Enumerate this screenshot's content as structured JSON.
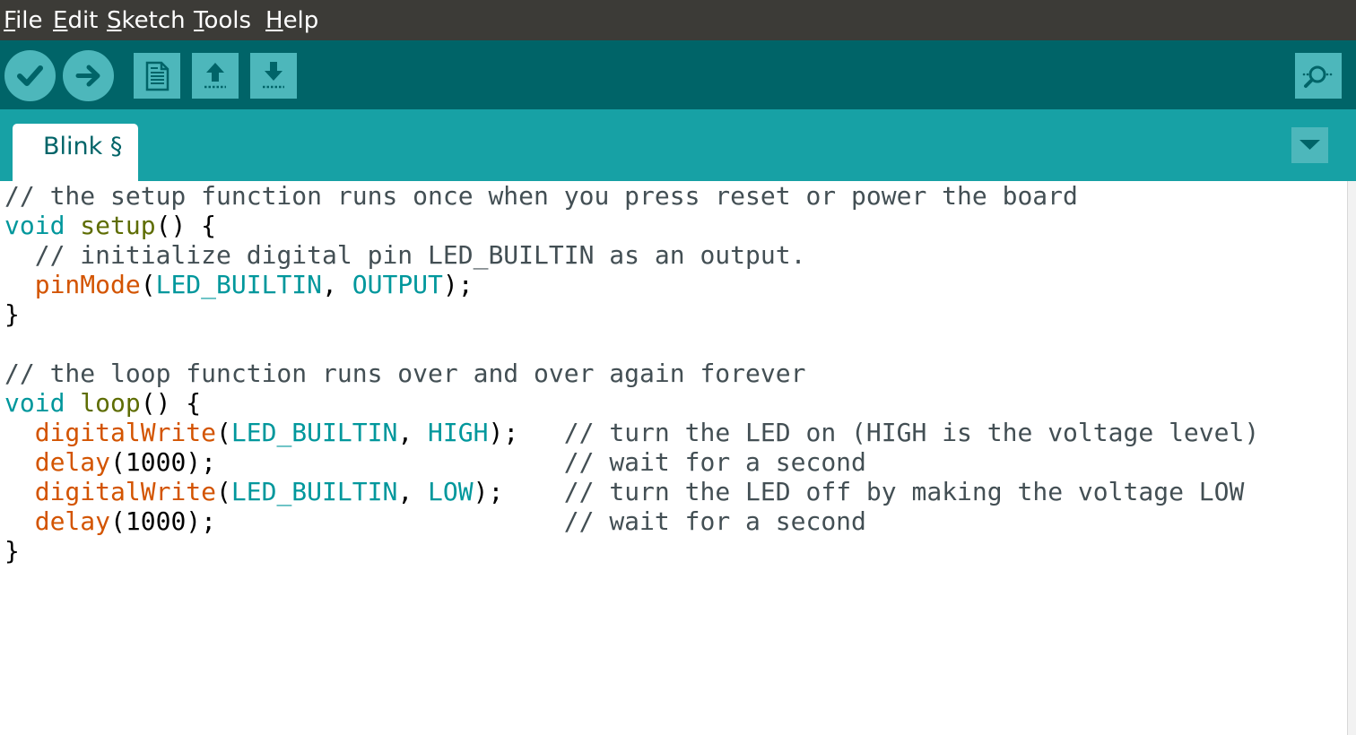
{
  "menubar": {
    "items": [
      {
        "mnemonic": "F",
        "rest": "ile"
      },
      {
        "mnemonic": "E",
        "rest": "dit"
      },
      {
        "mnemonic": "S",
        "rest": "ketch"
      },
      {
        "mnemonic": "T",
        "rest": "ools"
      },
      {
        "mnemonic": "H",
        "rest": "elp"
      }
    ]
  },
  "toolbar": {
    "buttons": [
      {
        "icon": "checkmark-icon"
      },
      {
        "icon": "arrow-right-icon"
      },
      {
        "icon": "new-file-icon"
      },
      {
        "icon": "upload-arrow-icon"
      },
      {
        "icon": "download-arrow-icon"
      },
      {
        "icon": "serial-monitor-magnifier-icon"
      }
    ]
  },
  "tabs": [
    {
      "label": "Blink §",
      "active": true
    }
  ],
  "tab_menu": {
    "icon": "triangle-down-icon"
  },
  "editor": {
    "lines": [
      [
        [
          "cm",
          "// the setup function runs once when you press reset or power the board"
        ]
      ],
      [
        [
          "kw",
          "void"
        ],
        [
          "pl",
          " "
        ],
        [
          "fn",
          "setup"
        ],
        [
          "pl",
          "() {"
        ]
      ],
      [
        [
          "pl",
          "  "
        ],
        [
          "cm",
          "// initialize digital pin LED_BUILTIN as an output."
        ]
      ],
      [
        [
          "pl",
          "  "
        ],
        [
          "cf",
          "pinMode"
        ],
        [
          "pl",
          "("
        ],
        [
          "ct",
          "LED_BUILTIN"
        ],
        [
          "pl",
          ", "
        ],
        [
          "ct",
          "OUTPUT"
        ],
        [
          "pl",
          ");"
        ]
      ],
      [
        [
          "pl",
          "}"
        ]
      ],
      [],
      [
        [
          "cm",
          "// the loop function runs over and over again forever"
        ]
      ],
      [
        [
          "kw",
          "void"
        ],
        [
          "pl",
          " "
        ],
        [
          "fn",
          "loop"
        ],
        [
          "pl",
          "() {"
        ]
      ],
      [
        [
          "pl",
          "  "
        ],
        [
          "cf",
          "digitalWrite"
        ],
        [
          "pl",
          "("
        ],
        [
          "ct",
          "LED_BUILTIN"
        ],
        [
          "pl",
          ", "
        ],
        [
          "ct",
          "HIGH"
        ],
        [
          "pl",
          ");   "
        ],
        [
          "cm",
          "// turn the LED on (HIGH is the voltage level)"
        ]
      ],
      [
        [
          "pl",
          "  "
        ],
        [
          "cf",
          "delay"
        ],
        [
          "pl",
          "(1000);                       "
        ],
        [
          "cm",
          "// wait for a second"
        ]
      ],
      [
        [
          "pl",
          "  "
        ],
        [
          "cf",
          "digitalWrite"
        ],
        [
          "pl",
          "("
        ],
        [
          "ct",
          "LED_BUILTIN"
        ],
        [
          "pl",
          ", "
        ],
        [
          "ct",
          "LOW"
        ],
        [
          "pl",
          ");    "
        ],
        [
          "cm",
          "// turn the LED off by making the voltage LOW"
        ]
      ],
      [
        [
          "pl",
          "  "
        ],
        [
          "cf",
          "delay"
        ],
        [
          "pl",
          "(1000);                       "
        ],
        [
          "cm",
          "// wait for a second"
        ]
      ],
      [
        [
          "pl",
          "}"
        ]
      ]
    ]
  },
  "colors": {
    "menubar_bg": "#3c3b37",
    "toolbar_bg": "#006468",
    "tabbar_bg": "#17a1a5",
    "button_bg": "#4db7bb",
    "comment": "#434f54",
    "keyword": "#00979c",
    "function": "#5e6d03",
    "core_function": "#d35400",
    "constant": "#00979c"
  }
}
